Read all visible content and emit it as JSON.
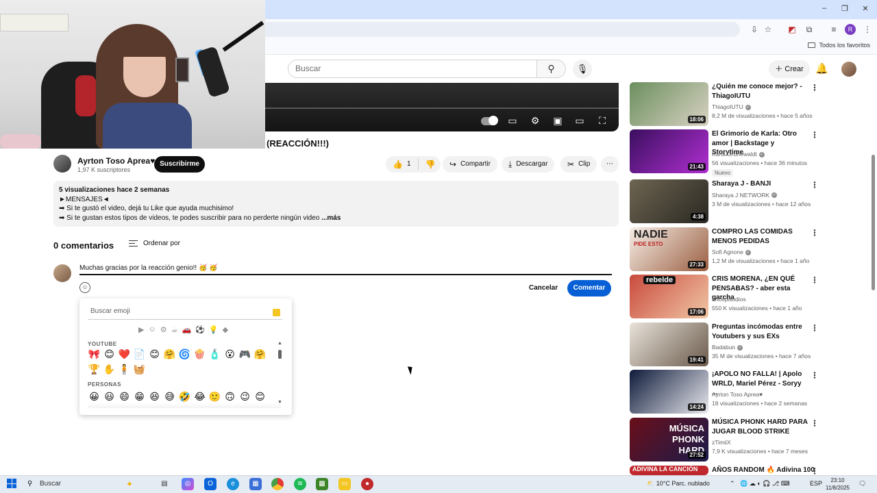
{
  "browser": {
    "bookmark_folder": "Todos los favoritos",
    "window_controls": [
      "–",
      "❐",
      "✕"
    ],
    "profile_initial": "R"
  },
  "header": {
    "search_placeholder": "Buscar",
    "create_label": "Crear"
  },
  "video": {
    "title": "(REACCIÓN!!!)"
  },
  "channel": {
    "name": "Ayrton Toso Aprea♥",
    "subscribers": "1,97 K suscriptores",
    "subscribe_label": "Suscribirme"
  },
  "actions": {
    "likes": "1",
    "share": "Compartir",
    "download": "Descargar",
    "clip": "Clip",
    "more": "⋯"
  },
  "description": {
    "meta": "5 visualizaciones  hace 2 semanas",
    "line1": "►MENSAJES◄",
    "line2": "➡ Si te gustó el video, dejá tu Like que ayuda muchisimo!",
    "line3": "➡ Si te gustan estos tipos de videos, te podes suscribir para no perderte ningún video",
    "more": "...más"
  },
  "comments": {
    "count": "0 comentarios",
    "sort": "Ordenar por",
    "input_value": "Muchas gracias por la reacción genio!! 🥳 🥳",
    "cancel": "Cancelar",
    "submit": "Comentar"
  },
  "emoji_picker": {
    "search_placeholder": "Buscar emoji",
    "categories": [
      "▶",
      "☺",
      "⚙",
      "☕",
      "🚗",
      "⚽",
      "💡",
      "◆"
    ],
    "section_youtube": "YOUTUBE",
    "section_people": "PERSONAS",
    "youtube_row1": [
      "🎀",
      "😊",
      "❤️",
      "📄",
      "😊",
      "🤗",
      "🌀",
      "🍿",
      "🧴",
      "😮",
      "🎮",
      "🤗"
    ],
    "youtube_row2": [
      "🏆",
      "✋",
      "🧍",
      "🧺"
    ],
    "people_row": [
      "😀",
      "😃",
      "😄",
      "😁",
      "😆",
      "😅",
      "🤣",
      "😂",
      "🙂",
      "🙃",
      "😉",
      "😊"
    ]
  },
  "recommendations": [
    {
      "title": "¿Quién me conoce mejor? - ThiagoIUTU",
      "channel": "ThiagoIUTU",
      "stats": "8,2 M de visualizaciones • hace 5 años",
      "duration": "18:06",
      "colors": [
        "#6b8f5e",
        "#d9d2c3"
      ],
      "verified": true,
      "badge": ""
    },
    {
      "title": "El Grimorio de Karla: Otro amor | Backstage y Storytime",
      "channel": "Karla Grunewaldt",
      "stats": "56 visualizaciones • hace 36 minutos",
      "duration": "21:43",
      "colors": [
        "#3a0f5e",
        "#b12fd3"
      ],
      "verified": true,
      "badge": "Nuevo"
    },
    {
      "title": "Sharaya J - BANJI",
      "channel": "Sharaya J NETWORK",
      "stats": "3 M de visualizaciones • hace 12 años",
      "duration": "4:38",
      "colors": [
        "#6e6552",
        "#2a2822"
      ],
      "verified": true,
      "badge": ""
    },
    {
      "title": "COMPRO LAS COMIDAS MENOS PEDIDAS",
      "channel": "Sofi Agnone",
      "stats": "1,2 M de visualizaciones • hace 1 año",
      "duration": "27:33",
      "colors": [
        "#f6eee6",
        "#9b5f42"
      ],
      "verified": true,
      "badge": "",
      "overlay": "NADIE",
      "overlay2": "PIDE ESTO"
    },
    {
      "title": "CRIS MORENA, ¿EN QUÉ PENSABAS? - aber esta garcha",
      "channel": "oncepisodios",
      "stats": "550 K visualizaciones • hace 1 año",
      "duration": "17:06",
      "colors": [
        "#c94a3d",
        "#f1c7a6"
      ],
      "verified": false,
      "badge": "",
      "overlay": "rebelde"
    },
    {
      "title": "Preguntas incómodas entre Youtubers y sus EXs",
      "channel": "Badabun",
      "stats": "35 M de visualizaciones • hace 7 años",
      "duration": "19:41",
      "colors": [
        "#e9e3da",
        "#6a5a4b"
      ],
      "verified": true,
      "badge": ""
    },
    {
      "title": "¡APOLO NO FALLA! | Apolo WRLD, Mariel Pérez - Soryy ...",
      "channel": "Ayrton Toso Aprea♥",
      "stats": "18 visualizaciones • hace 2 semanas",
      "duration": "14:24",
      "colors": [
        "#0d1a3a",
        "#e9e9ee"
      ],
      "verified": false,
      "badge": ""
    },
    {
      "title": "MÚSICA PHONK HARD PARA JUGAR BLOOD STRIKE",
      "channel": "zTimiiX",
      "stats": "7,9 K visualizaciones • hace 7 meses",
      "duration": "27:52",
      "colors": [
        "#6a0f1a",
        "#1b1b4a"
      ],
      "verified": false,
      "badge": "",
      "overlay": "MÚSICA",
      "overlay2": "PHONK",
      "overlay3": "HARD"
    },
    {
      "title": "AÑOS RANDOM 🔥 Adivina 100",
      "channel": "",
      "stats": "",
      "duration": "",
      "colors": [
        "#2a2a2a",
        "#555"
      ],
      "verified": false,
      "badge": "",
      "overlay": "ADIVINA LA CANCIÓN"
    }
  ],
  "taskbar": {
    "search": "Buscar",
    "weather": "10°C  Parc. nublado",
    "language": "ESP",
    "time": "23:10",
    "date": "11/8/2025"
  }
}
